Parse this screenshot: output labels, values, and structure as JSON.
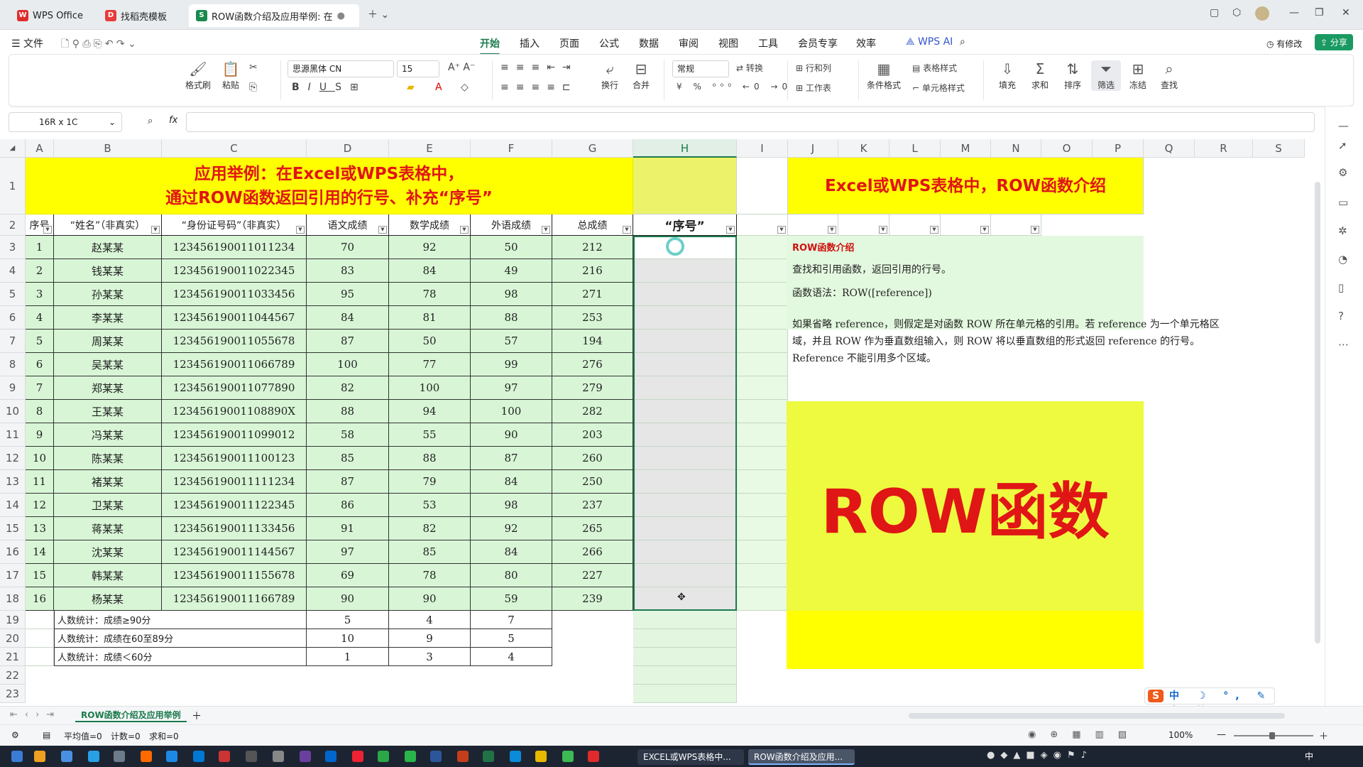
{
  "tabs": {
    "home": "WPS Office",
    "template": "找稻壳模板",
    "doc": "ROW函数介绍及应用举例: 在"
  },
  "menu": {
    "file": "文件",
    "items": [
      "开始",
      "插入",
      "页面",
      "公式",
      "数据",
      "审阅",
      "视图",
      "工具",
      "会员专享",
      "效率"
    ],
    "ai": "WPS AI",
    "modified": "有修改",
    "share": "分享"
  },
  "ribbon": {
    "format_painter": "格式刷",
    "paste": "粘贴",
    "font": "思源黑体 CN",
    "size": "15",
    "wrap": "换行",
    "merge": "合并",
    "numfmt": "常规",
    "convert": "转换",
    "rowcol": "行和列",
    "sheet": "工作表",
    "cond": "条件格式",
    "tblstyle": "表格样式",
    "cellstyle": "单元格样式",
    "fill": "填充",
    "sum": "求和",
    "sort": "排序",
    "filter": "筛选",
    "freeze": "冻结",
    "find": "查找"
  },
  "formula": {
    "namebox": "16R x 1C",
    "fx": "fx"
  },
  "columns": [
    "A",
    "B",
    "C",
    "D",
    "E",
    "F",
    "G",
    "H",
    "I",
    "J",
    "K",
    "L",
    "M",
    "N",
    "O",
    "P",
    "Q",
    "R",
    "S"
  ],
  "title_left": {
    "line1": "应用举例：在Excel或WPS表格中，",
    "line2": "通过ROW函数返回引用的行号、补充“序号”"
  },
  "title_right": "Excel或WPS表格中，ROW函数介绍",
  "headers": [
    "序号",
    "“姓名”（非真实）",
    "“身份证号码”（非真实）",
    "语文成绩",
    "数学成绩",
    "外语成绩",
    "总成绩",
    "“序号”"
  ],
  "rows": [
    [
      "1",
      "赵某某",
      "123456190011011234",
      "70",
      "92",
      "50",
      "212"
    ],
    [
      "2",
      "钱某某",
      "123456190011022345",
      "83",
      "84",
      "49",
      "216"
    ],
    [
      "3",
      "孙某某",
      "123456190011033456",
      "95",
      "78",
      "98",
      "271"
    ],
    [
      "4",
      "李某某",
      "123456190011044567",
      "84",
      "81",
      "88",
      "253"
    ],
    [
      "5",
      "周某某",
      "123456190011055678",
      "87",
      "50",
      "57",
      "194"
    ],
    [
      "6",
      "吴某某",
      "123456190011066789",
      "100",
      "77",
      "99",
      "276"
    ],
    [
      "7",
      "郑某某",
      "123456190011077890",
      "82",
      "100",
      "97",
      "279"
    ],
    [
      "8",
      "王某某",
      "12345619001108890X",
      "88",
      "94",
      "100",
      "282"
    ],
    [
      "9",
      "冯某某",
      "123456190011099012",
      "58",
      "55",
      "90",
      "203"
    ],
    [
      "10",
      "陈某某",
      "123456190011100123",
      "85",
      "88",
      "87",
      "260"
    ],
    [
      "11",
      "褚某某",
      "123456190011111234",
      "87",
      "79",
      "84",
      "250"
    ],
    [
      "12",
      "卫某某",
      "123456190011122345",
      "86",
      "53",
      "98",
      "237"
    ],
    [
      "13",
      "蒋某某",
      "123456190011133456",
      "91",
      "82",
      "92",
      "265"
    ],
    [
      "14",
      "沈某某",
      "123456190011144567",
      "97",
      "85",
      "84",
      "266"
    ],
    [
      "15",
      "韩某某",
      "123456190011155678",
      "69",
      "78",
      "80",
      "227"
    ],
    [
      "16",
      "杨某某",
      "123456190011166789",
      "90",
      "90",
      "59",
      "239"
    ]
  ],
  "stats": [
    {
      "label": "人数统计：成绩≥90分",
      "d": "5",
      "e": "4",
      "f": "7"
    },
    {
      "label": "人数统计：成绩在60至89分",
      "d": "10",
      "e": "9",
      "f": "5"
    },
    {
      "label": "人数统计：成绩＜60分",
      "d": "1",
      "e": "3",
      "f": "4"
    }
  ],
  "intro": {
    "heading": "ROW函数介绍",
    "l1": "查找和引用函数，返回引用的行号。",
    "l2": "函数语法：ROW([reference])",
    "p1": "如果省略 reference，则假定是对函数 ROW 所在单元格的引用。若 reference 为一个单元格区",
    "p2": "域，并且 ROW 作为垂直数组输入，则 ROW 将以垂直数组的形式返回 reference 的行号。",
    "p3": "Reference 不能引用多个区域。",
    "big": "ROW函数"
  },
  "ime": "中",
  "sheet": {
    "name": "ROW函数介绍及应用举例"
  },
  "status": {
    "avg": "平均值=0",
    "count": "计数=0",
    "sum": "求和=0",
    "zoom": "100%"
  },
  "taskbar": {
    "t1": "EXCEL或WPS表格中...",
    "t2": "ROW函数介绍及应用..."
  }
}
